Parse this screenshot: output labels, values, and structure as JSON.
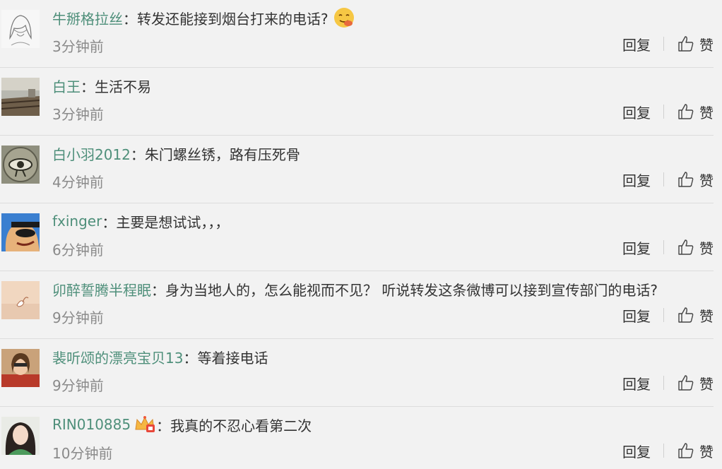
{
  "actions": {
    "reply_label": "回复",
    "like_label": "赞"
  },
  "separator": "：",
  "comments": [
    {
      "user": "牛掰格拉丝",
      "text": "转发还能接到烟台打来的电话?",
      "time": "3分钟前"
    },
    {
      "user": "白王",
      "text": "生活不易",
      "time": "3分钟前"
    },
    {
      "user": "白小羽2012",
      "text": "朱门螺丝锈，路有压死骨",
      "time": "4分钟前"
    },
    {
      "user": "fxinger",
      "text": "主要是想试试，，，",
      "time": "6分钟前"
    },
    {
      "user": "卯醉誓腾半程眠",
      "text": "身为当地人的，怎么能视而不见？ 听说转发这条微博可以接到宣传部门的电话?",
      "time": "9分钟前"
    },
    {
      "user": "裴听颂的漂亮宝贝13",
      "text": "等着接电话",
      "time": "9分钟前"
    },
    {
      "user": "RIN010885",
      "text": "我真的不忍心看第二次",
      "time": "10分钟前"
    }
  ],
  "colors": {
    "username": "#4e8f7a",
    "time": "#8a8a8a",
    "background": "#f2f2f2"
  }
}
